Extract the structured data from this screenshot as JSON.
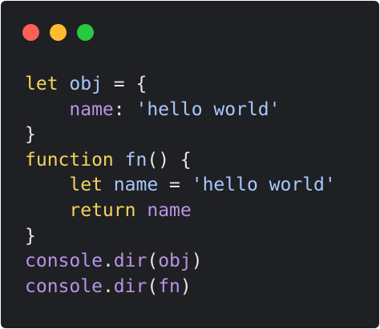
{
  "window": {
    "controls": [
      {
        "name": "close",
        "color": "#fe5f57"
      },
      {
        "name": "minimize",
        "color": "#febc2e"
      },
      {
        "name": "maximize",
        "color": "#28c840"
      }
    ]
  },
  "code": {
    "lines": [
      [
        {
          "t": "let",
          "c": "kw"
        },
        {
          "t": " ",
          "c": "punc"
        },
        {
          "t": "obj",
          "c": "var"
        },
        {
          "t": " = {",
          "c": "punc"
        }
      ],
      [
        {
          "t": "    ",
          "c": "punc"
        },
        {
          "t": "name",
          "c": "prop"
        },
        {
          "t": ": ",
          "c": "punc"
        },
        {
          "t": "'hello world'",
          "c": "str"
        }
      ],
      [
        {
          "t": "}",
          "c": "punc"
        }
      ],
      [
        {
          "t": "function",
          "c": "kw"
        },
        {
          "t": " ",
          "c": "punc"
        },
        {
          "t": "fn",
          "c": "fn"
        },
        {
          "t": "() {",
          "c": "punc"
        }
      ],
      [
        {
          "t": "    ",
          "c": "punc"
        },
        {
          "t": "let",
          "c": "kw"
        },
        {
          "t": " ",
          "c": "punc"
        },
        {
          "t": "name",
          "c": "var"
        },
        {
          "t": " = ",
          "c": "punc"
        },
        {
          "t": "'hello world'",
          "c": "str"
        }
      ],
      [
        {
          "t": "    ",
          "c": "punc"
        },
        {
          "t": "return",
          "c": "ret"
        },
        {
          "t": " ",
          "c": "punc"
        },
        {
          "t": "name",
          "c": "prop"
        }
      ],
      [
        {
          "t": "}",
          "c": "punc"
        }
      ],
      [
        {
          "t": "console",
          "c": "con"
        },
        {
          "t": ".",
          "c": "punc"
        },
        {
          "t": "dir",
          "c": "con"
        },
        {
          "t": "(",
          "c": "punc"
        },
        {
          "t": "obj",
          "c": "con"
        },
        {
          "t": ")",
          "c": "punc"
        }
      ],
      [
        {
          "t": "console",
          "c": "con"
        },
        {
          "t": ".",
          "c": "punc"
        },
        {
          "t": "dir",
          "c": "con"
        },
        {
          "t": "(",
          "c": "punc"
        },
        {
          "t": "fn",
          "c": "con"
        },
        {
          "t": ")",
          "c": "punc"
        }
      ]
    ]
  }
}
